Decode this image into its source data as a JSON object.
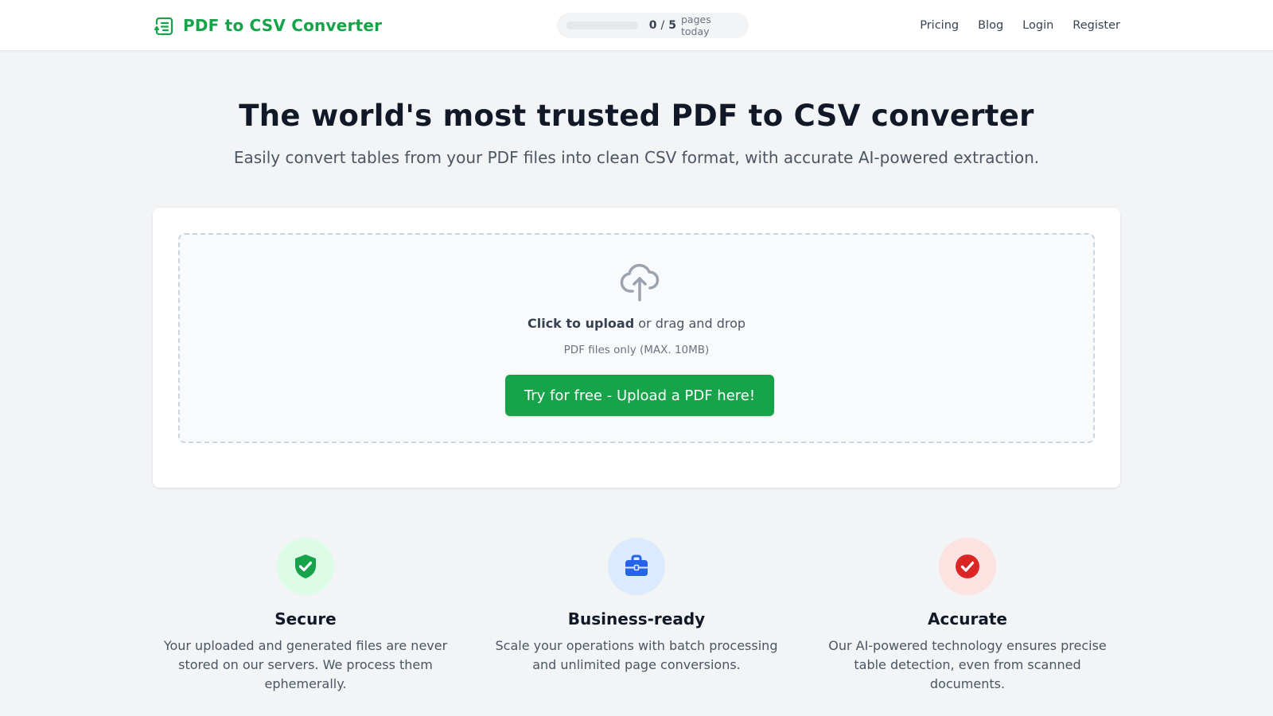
{
  "header": {
    "brand": {
      "name": "PDF to CSV Converter",
      "icon": "document-list-icon",
      "color": "#16a34a"
    },
    "usage": {
      "used": "0",
      "limit": "5",
      "suffix": "pages today",
      "progress_fraction": 0
    },
    "nav": [
      {
        "label": "Pricing"
      },
      {
        "label": "Blog"
      },
      {
        "label": "Login"
      },
      {
        "label": "Register"
      }
    ]
  },
  "hero": {
    "title": "The world's most trusted PDF to CSV converter",
    "subtitle": "Easily convert tables from your PDF files into clean CSV format, with accurate AI-powered extraction."
  },
  "upload": {
    "icon": "cloud-upload-icon",
    "click_label": "Click to upload",
    "drag_label": "or drag and drop",
    "hint": "PDF files only (MAX. 10MB)",
    "cta_label": "Try for free - Upload a PDF here!"
  },
  "features": [
    {
      "title": "Secure",
      "text": "Your uploaded and generated files are never stored on our servers. We process them ephemerally.",
      "icon": "shield-check-icon",
      "badge_color": "#dcfce7",
      "icon_color": "#16a34a"
    },
    {
      "title": "Business-ready",
      "text": "Scale your operations with batch processing and unlimited page conversions.",
      "icon": "briefcase-icon",
      "badge_color": "#dbeafe",
      "icon_color": "#2563eb"
    },
    {
      "title": "Accurate",
      "text": "Our AI-powered technology ensures precise table detection, even from scanned documents.",
      "icon": "check-circle-icon",
      "badge_color": "#fee2e2",
      "icon_color": "#dc2626"
    }
  ]
}
